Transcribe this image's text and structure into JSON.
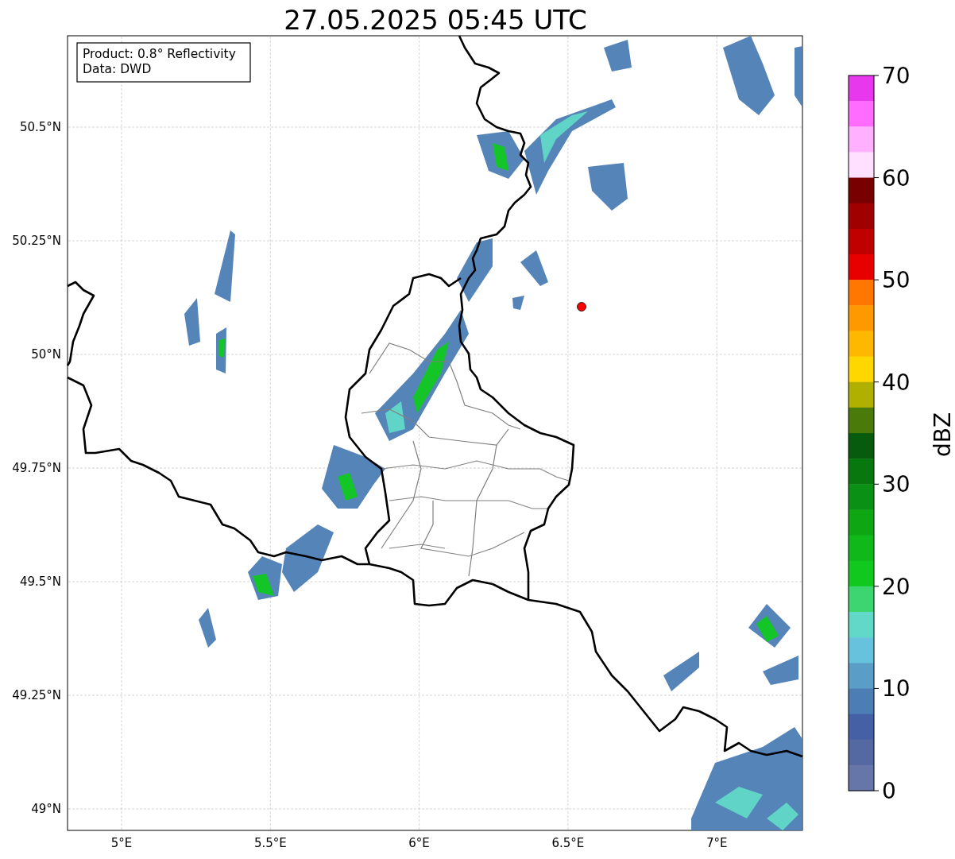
{
  "title": "27.05.2025 05:45 UTC",
  "info_box": [
    "Product: 0.8° Reflectivity",
    "Data: DWD"
  ],
  "map": {
    "lat_ticks": [
      "50.5°N",
      "50.25°N",
      "50°N",
      "49.75°N",
      "49.5°N",
      "49.25°N",
      "49°N"
    ],
    "lon_ticks": [
      "5°E",
      "5.5°E",
      "6°E",
      "6.5°E",
      "7°E"
    ]
  },
  "colorbar": {
    "label": "dBZ",
    "ticks": [
      "70",
      "60",
      "50",
      "40",
      "30",
      "20",
      "10",
      "0"
    ],
    "levels": [
      {
        "color": "#e838ee"
      },
      {
        "color": "#ff6cff"
      },
      {
        "color": "#ffb0ff"
      },
      {
        "color": "#ffe0ff"
      },
      {
        "color": "#780000"
      },
      {
        "color": "#a00000"
      },
      {
        "color": "#c00000"
      },
      {
        "color": "#e60000"
      },
      {
        "color": "#ff7700"
      },
      {
        "color": "#ff9900"
      },
      {
        "color": "#ffb800"
      },
      {
        "color": "#ffd700"
      },
      {
        "color": "#b0b000"
      },
      {
        "color": "#4a7a0a"
      },
      {
        "color": "#065c0c"
      },
      {
        "color": "#08780e"
      },
      {
        "color": "#0a9015"
      },
      {
        "color": "#0ea612"
      },
      {
        "color": "#10b81a"
      },
      {
        "color": "#10c81e"
      },
      {
        "color": "#3dd56f"
      },
      {
        "color": "#62d8c8"
      },
      {
        "color": "#67c3dd"
      },
      {
        "color": "#5a9ec8"
      },
      {
        "color": "#4c7db4"
      },
      {
        "color": "#4560a4"
      },
      {
        "color": "#5468a2"
      },
      {
        "color": "#6676a9"
      }
    ]
  }
}
